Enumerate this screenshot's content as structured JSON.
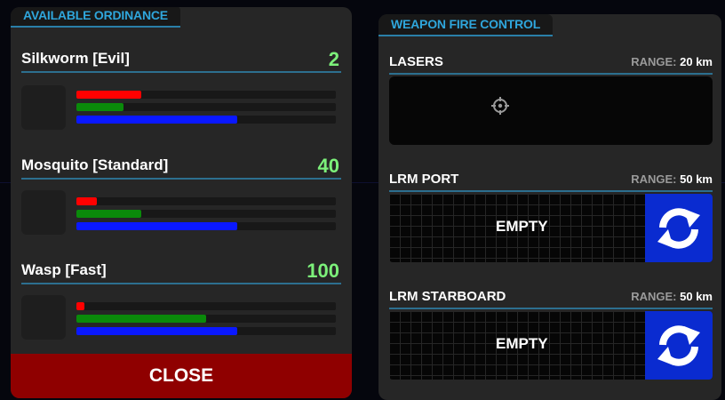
{
  "ordinance_panel": {
    "title": "AVAILABLE ORDINANCE",
    "items": [
      {
        "name": "Silkworm [Evil]",
        "count": "2",
        "bars": {
          "red": 0.25,
          "green": 0.18,
          "blue": 0.62
        }
      },
      {
        "name": "Mosquito [Standard]",
        "count": "40",
        "bars": {
          "red": 0.08,
          "green": 0.25,
          "blue": 0.62
        }
      },
      {
        "name": "Wasp [Fast]",
        "count": "100",
        "bars": {
          "red": 0.03,
          "green": 0.5,
          "blue": 0.62
        }
      }
    ],
    "close_label": "CLOSE"
  },
  "fire_control_panel": {
    "title": "WEAPON FIRE CONTROL",
    "range_label": "RANGE:",
    "sections": {
      "lasers": {
        "name": "LASERS",
        "range": "20 km",
        "icon": "crosshair-icon"
      },
      "lrm_port": {
        "name": "LRM PORT",
        "range": "50 km",
        "status": "EMPTY",
        "icon": "reload-icon"
      },
      "lrm_starboard": {
        "name": "LRM STARBOARD",
        "range": "50 km",
        "status": "EMPTY",
        "icon": "reload-icon"
      }
    }
  },
  "colors": {
    "accent": "#2fa6dc",
    "count": "#7cf07a",
    "close": "#8f0000",
    "reload": "#0a2bd0",
    "bar_red": "#ff0000",
    "bar_green": "#0a8a0a",
    "bar_blue": "#0a18ff"
  }
}
